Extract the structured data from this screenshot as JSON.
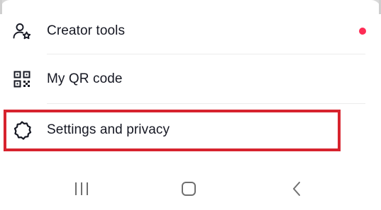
{
  "menu": {
    "items": [
      {
        "label": "Creator tools",
        "icon": "person-star-icon",
        "has_badge": true
      },
      {
        "label": "My QR code",
        "icon": "qr-code-icon",
        "has_badge": false
      },
      {
        "label": "Settings and privacy",
        "icon": "gear-icon",
        "has_badge": false,
        "highlighted": true
      }
    ]
  },
  "navbar": {
    "buttons": [
      {
        "name": "recent-apps",
        "icon": "recent-apps-icon"
      },
      {
        "name": "home",
        "icon": "home-icon"
      },
      {
        "name": "back",
        "icon": "back-icon"
      }
    ]
  },
  "colors": {
    "badge": "#fe2c55",
    "highlight_border": "#d7232e",
    "text": "#161823",
    "background": "#ffffff"
  }
}
